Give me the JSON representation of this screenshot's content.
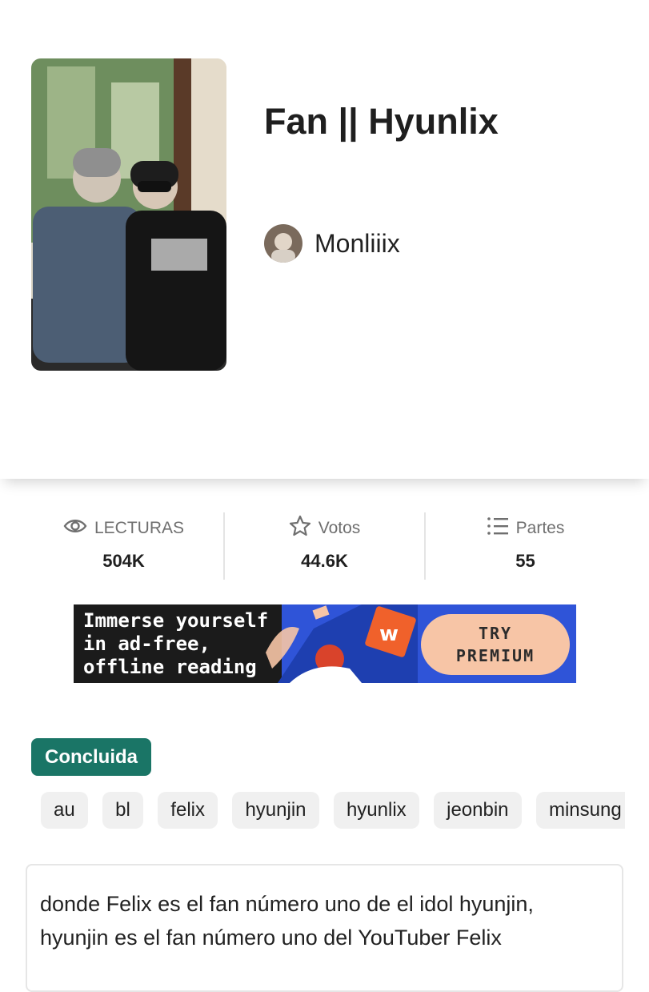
{
  "story": {
    "title": "Fan || Hyunlix",
    "author": "Monliiix"
  },
  "stats": [
    {
      "label": "LECTURAS",
      "value": "504K",
      "icon": "eye-icon"
    },
    {
      "label": "Votos",
      "value": "44.6K",
      "icon": "star-icon"
    },
    {
      "label": "Partes",
      "value": "55",
      "icon": "list-icon"
    }
  ],
  "ad": {
    "line1": "Immerse yourself",
    "line2": "in ad-free,",
    "line3": "offline reading",
    "button_line1": "TRY",
    "button_line2": "PREMIUM"
  },
  "status_badge": "Concluida",
  "tags": [
    "au",
    "bl",
    "felix",
    "hyunjin",
    "hyunlix",
    "jeonbin",
    "minsung"
  ],
  "description": {
    "line1": "donde Felix es el fan número uno de el idol hyunjin,",
    "line2": "hyunjin es el fan número uno del YouTuber Felix"
  },
  "colors": {
    "badge": "#1a7566",
    "ad_button": "#f7c5a6",
    "ad_bg": "#1b1b1b"
  }
}
